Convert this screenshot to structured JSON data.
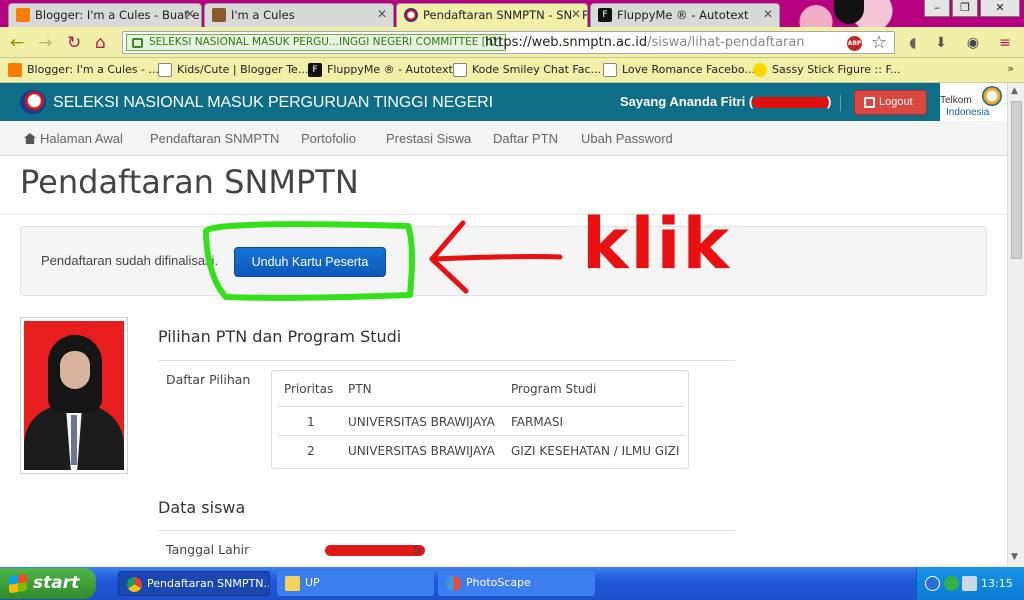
{
  "browser": {
    "tabs": [
      {
        "label": "Blogger: I'm a Cules - Buat e",
        "icon": "blogger-icon",
        "active": false
      },
      {
        "label": "I'm a Cules",
        "icon": "blog-favicon-icon",
        "active": false
      },
      {
        "label": "Pendaftaran SNMPTN - SNMP",
        "icon": "snmptn-icon",
        "active": true
      },
      {
        "label": "FluppyMe ® - Autotext",
        "icon": "fluppyme-icon",
        "active": false
      }
    ],
    "ev_label": "SELEKSI NASIONAL MASUK PERGU...INGGI NEGERI  COMMITTEE [ID]",
    "url_host": "https://web.snmptn.ac.id",
    "url_path": "/siswa/lihat-pendaftaran",
    "abp_label": "ABP",
    "bookmarks": [
      {
        "label": "Blogger: I'm a Cules - ...",
        "icon": "blogger-icon"
      },
      {
        "label": "Kids/Cute | Blogger Te...",
        "icon": "page-icon"
      },
      {
        "label": "FluppyMe ® - Autotext",
        "icon": "fluppyme-icon"
      },
      {
        "label": "Kode Smiley Chat Fac...",
        "icon": "smiley-code-icon"
      },
      {
        "label": "Love Romance Facebo...",
        "icon": "page-icon"
      },
      {
        "label": "Sassy Stick Figure :: F...",
        "icon": "smiley-icon"
      }
    ],
    "bookmarks_more": "»"
  },
  "site": {
    "title": "SELEKSI NASIONAL MASUK PERGURUAN TINGGI NEGERI",
    "user_prefix": "Sayang Ananda Fitri (",
    "user_suffix": ")",
    "logout_label": "Logout",
    "sponsor_line1": "Telkom",
    "sponsor_line2": "Indonesia"
  },
  "nav": [
    {
      "label": "Halaman Awal",
      "icon": "home-icon"
    },
    {
      "label": "Pendaftaran SNMPTN"
    },
    {
      "label": "Portofolio"
    },
    {
      "label": "Prestasi Siswa"
    },
    {
      "label": "Daftar PTN"
    },
    {
      "label": "Ubah Password"
    }
  ],
  "page": {
    "title": "Pendaftaran SNMPTN",
    "finalized_text": "Pendaftaran sudah difinalisasi.",
    "download_button": "Unduh Kartu Peserta",
    "annotation_text": "klik",
    "section_ptn_title": "Pilihan PTN dan Program Studi",
    "daftar_pilihan_label": "Daftar Pilihan",
    "table": {
      "headers": [
        "Prioritas",
        "PTN",
        "Program Studi"
      ],
      "rows": [
        [
          "1",
          "UNIVERSITAS BRAWIJAYA",
          "FARMASI"
        ],
        [
          "2",
          "UNIVERSITAS BRAWIJAYA",
          "GIZI KESEHATAN / ILMU GIZI"
        ]
      ]
    },
    "section_student_title": "Data siswa",
    "birthdate_label": "Tanggal Lahir",
    "birthdate_visible_tail": "5"
  },
  "taskbar": {
    "start_label": "start",
    "tasks": [
      {
        "label": "Pendaftaran SNMPTN...",
        "icon": "chrome-icon"
      },
      {
        "label": "UP",
        "icon": "folder-icon"
      },
      {
        "label": "PhotoScape",
        "icon": "photoscape-icon"
      }
    ],
    "clock": "13:15"
  },
  "colors": {
    "chrome_theme": "#b5007f",
    "toolbar": "#f0f0a8",
    "site_header": "#0e6e87",
    "logout_button": "#d9473f",
    "primary_button": "#0c59b8",
    "annotation_red": "#e81010",
    "annotation_green": "#33e01a",
    "taskbar": "#2159d8"
  }
}
